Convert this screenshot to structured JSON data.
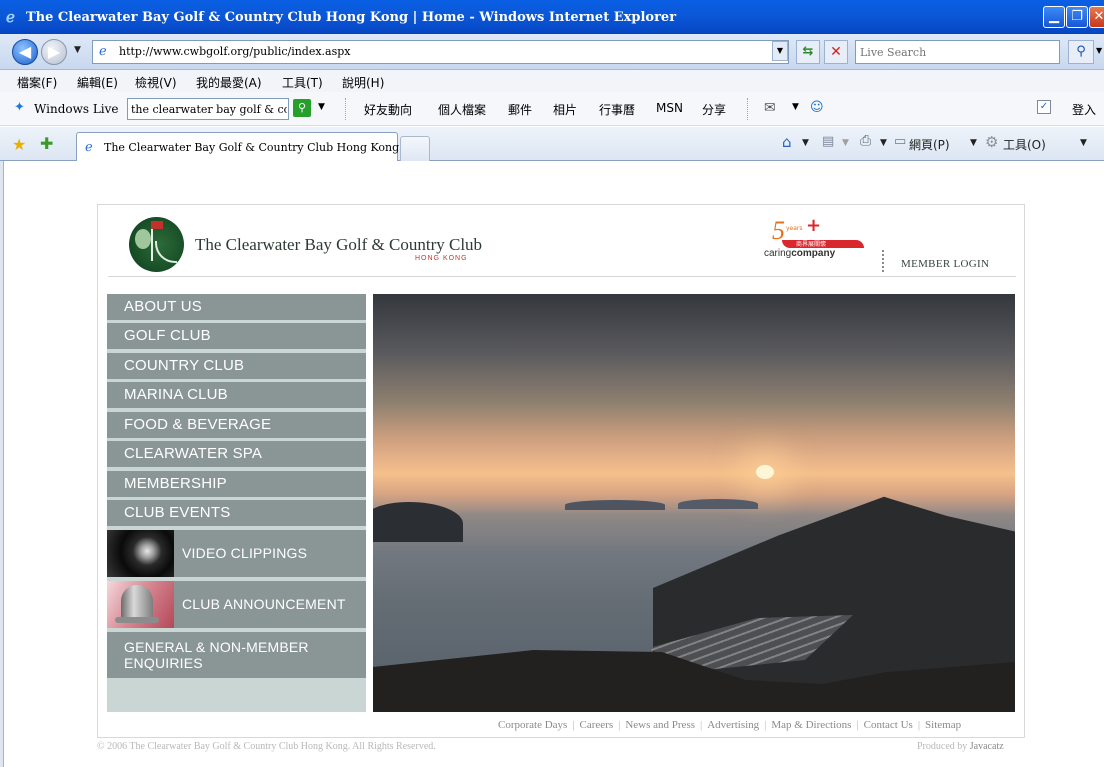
{
  "window": {
    "title": "The Clearwater Bay Golf & Country Club Hong Kong | Home - Windows Internet Explorer",
    "minimize_glyph": "▁",
    "maximize_glyph": "❐",
    "close_glyph": "✕"
  },
  "address": {
    "url": "http://www.cwbgolf.org/public/index.aspx",
    "search_placeholder": "Live Search"
  },
  "menu": [
    "檔案(F)",
    "編輯(E)",
    "檢視(V)",
    "我的最愛(A)",
    "工具(T)",
    "說明(H)"
  ],
  "links_bar": {
    "brand": "Windows Live",
    "search_value": "the clearwater bay golf & coun",
    "links": [
      "好友動向",
      "個人檔案",
      "郵件",
      "相片",
      "行事曆",
      "MSN",
      "分享"
    ],
    "signin": "登入"
  },
  "tabs": {
    "active_label": "The Clearwater Bay Golf & Country Club Hong Kong l...",
    "tools": {
      "page": "網頁(P)",
      "tools": "工具(O)"
    }
  },
  "site": {
    "club_name": "The Clearwater Bay Golf & Country Club",
    "club_sub": "HONG KONG",
    "caring": {
      "years_number": "5",
      "years_word": "years",
      "plus": "+",
      "cn": "商界展關懷",
      "brand_a": "caring",
      "brand_b": "company"
    },
    "member_login": "MEMBER LOGIN",
    "nav": [
      "ABOUT US",
      "GOLF CLUB",
      "COUNTRY CLUB",
      "MARINA CLUB",
      "FOOD & BEVERAGE",
      "CLEARWATER SPA",
      "MEMBERSHIP",
      "CLUB EVENTS",
      "VIDEO CLIPPINGS",
      "CLUB ANNOUNCEMENT",
      "GENERAL & NON-MEMBER ENQUIRIES"
    ],
    "footer_links": [
      "Corporate Days",
      "Careers",
      "News and Press",
      "Advertising",
      "Map & Directions",
      "Contact Us",
      "Sitemap"
    ],
    "copyright": "© 2006 The Clearwater Bay Golf & Country Club Hong Kong. All Rights Reserved.",
    "produced_by": "Produced by",
    "producer": "Javacatz"
  }
}
